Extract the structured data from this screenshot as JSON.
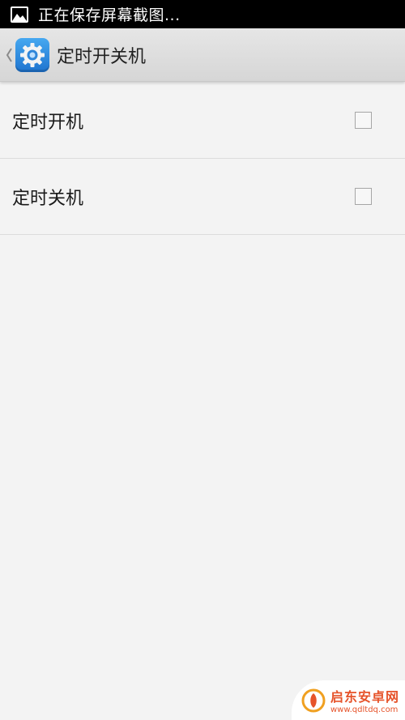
{
  "status_bar": {
    "notification_icon": "picture-icon",
    "text": "正在保存屏幕截图..."
  },
  "action_bar": {
    "back_icon": "chevron-left-icon",
    "app_icon": "gear-icon",
    "title": "定时开关机"
  },
  "settings": {
    "items": [
      {
        "label": "定时开机",
        "checked": false
      },
      {
        "label": "定时关机",
        "checked": false
      }
    ]
  },
  "watermark": {
    "name": "启东安卓网",
    "url": "www.qdltdq.com"
  },
  "colors": {
    "status_bar_bg": "#000000",
    "action_bar_bg": "#dcdcdc",
    "page_bg": "#f3f3f3",
    "app_icon_blue": "#2d8be0",
    "watermark_orange": "#e6532a"
  }
}
